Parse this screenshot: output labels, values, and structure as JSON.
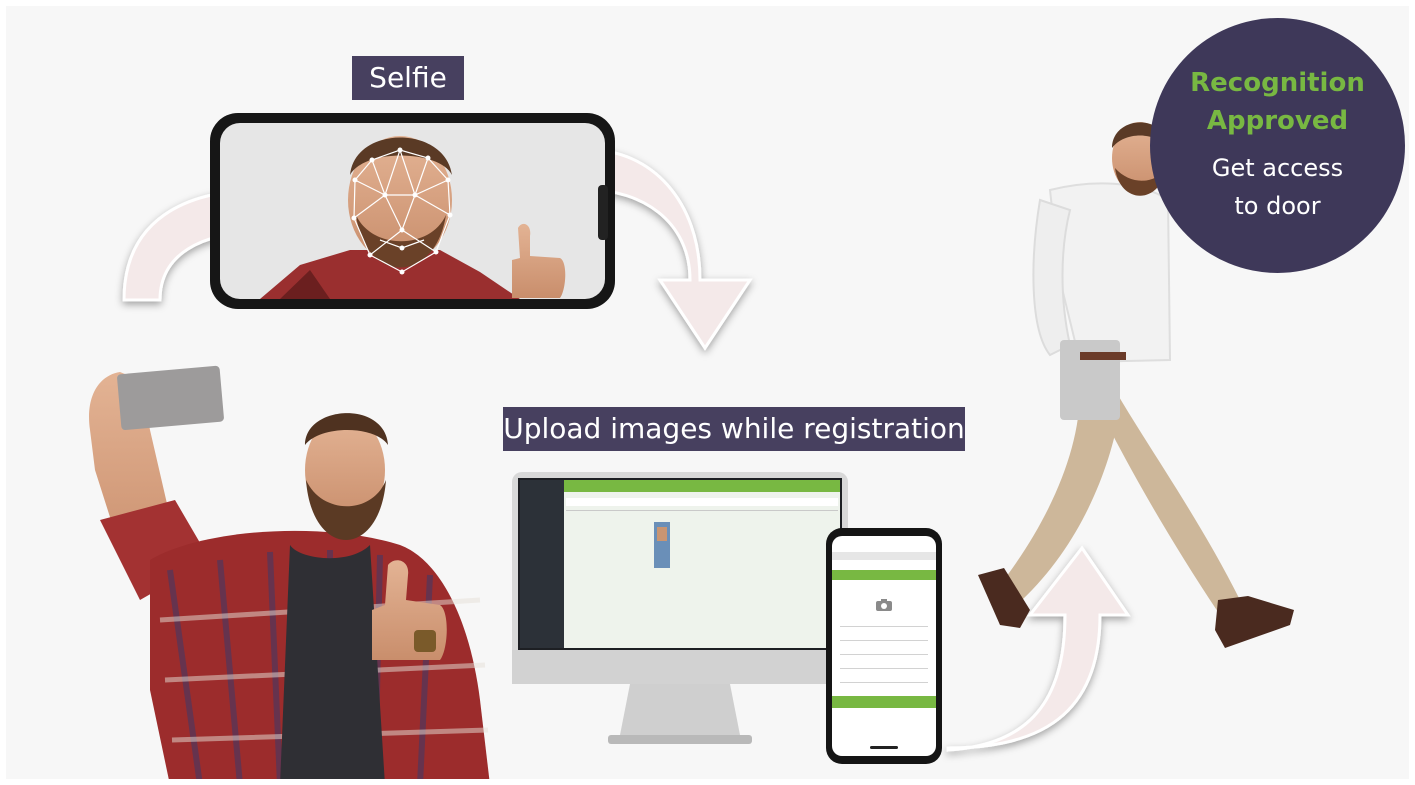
{
  "labels": {
    "selfie": "Selfie",
    "upload": "Upload images while registration"
  },
  "badge": {
    "title_line1": "Recognition",
    "title_line2": "Approved",
    "body_line1": "Get access",
    "body_line2": "to door"
  },
  "colors": {
    "label_bg": "#47405f",
    "badge_bg": "#3e3859",
    "accent_green": "#78b842",
    "arrow_fill": "#f4e9e9"
  },
  "icons": {
    "camera": "camera-icon"
  }
}
